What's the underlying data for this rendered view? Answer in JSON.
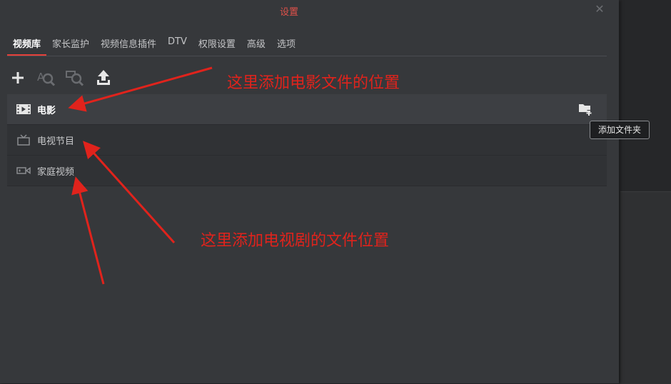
{
  "dialog": {
    "title": "设置",
    "close_glyph": "✕"
  },
  "tabs": [
    {
      "label": "视频库",
      "active": true
    },
    {
      "label": "家长监护",
      "active": false
    },
    {
      "label": "视频信息插件",
      "active": false
    },
    {
      "label": "DTV",
      "active": false
    },
    {
      "label": "权限设置",
      "active": false
    },
    {
      "label": "高级",
      "active": false
    },
    {
      "label": "选项",
      "active": false
    }
  ],
  "toolbar": {
    "buttons": [
      {
        "icon": "plus-icon"
      },
      {
        "icon": "search-scan-icon"
      },
      {
        "icon": "scan-media-icon"
      },
      {
        "icon": "upload-icon"
      }
    ]
  },
  "libraries": [
    {
      "name": "电影",
      "icon": "movie-icon",
      "selected": true
    },
    {
      "name": "电视节目",
      "icon": "tv-icon",
      "selected": false
    },
    {
      "name": "家庭视频",
      "icon": "video-camera-icon",
      "selected": false
    }
  ],
  "tooltip": "添加文件夹",
  "annotations": {
    "movie_note": "这里添加电影文件的位置",
    "tv_note": "这里添加电视剧的文件位置"
  },
  "colors": {
    "accent": "#e5403a",
    "annotation": "#e0231c",
    "dialog_bg": "#36383b"
  }
}
